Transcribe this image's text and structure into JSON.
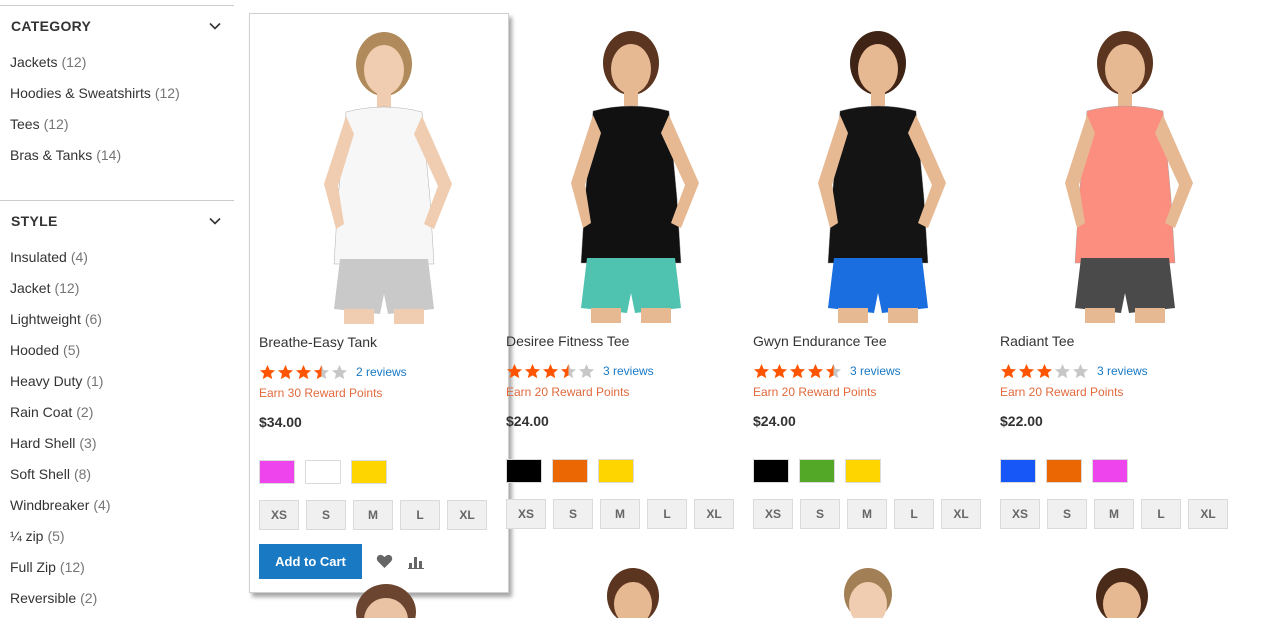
{
  "filters": {
    "category": {
      "title": "CATEGORY",
      "items": [
        {
          "label": "Jackets",
          "count": "(12)"
        },
        {
          "label": "Hoodies & Sweatshirts",
          "count": "(12)"
        },
        {
          "label": "Tees",
          "count": "(12)"
        },
        {
          "label": "Bras & Tanks",
          "count": "(14)"
        }
      ]
    },
    "style": {
      "title": "STYLE",
      "items": [
        {
          "label": "Insulated",
          "count": "(4)"
        },
        {
          "label": "Jacket",
          "count": "(12)"
        },
        {
          "label": "Lightweight",
          "count": "(6)"
        },
        {
          "label": "Hooded",
          "count": "(5)"
        },
        {
          "label": "Heavy Duty",
          "count": "(1)"
        },
        {
          "label": "Rain Coat",
          "count": "(2)"
        },
        {
          "label": "Hard Shell",
          "count": "(3)"
        },
        {
          "label": "Soft Shell",
          "count": "(8)"
        },
        {
          "label": "Windbreaker",
          "count": "(4)"
        },
        {
          "label": "¼ zip",
          "count": "(5)"
        },
        {
          "label": "Full Zip",
          "count": "(12)"
        },
        {
          "label": "Reversible",
          "count": "(2)"
        }
      ]
    }
  },
  "products": [
    {
      "name": "Breathe-Easy Tank",
      "rating": 3.5,
      "reviews": "2 reviews",
      "points": "Earn 30 Reward Points",
      "price": "$34.00",
      "swatches": [
        "#ee44ee",
        "#ffffff",
        "#ffd500"
      ],
      "top_color": "#f7f7f7",
      "bottom_color": "#c9c9c9",
      "hair_color": "#b08a5a"
    },
    {
      "name": "Desiree Fitness Tee",
      "rating": 3.5,
      "reviews": "3 reviews",
      "points": "Earn 20 Reward Points",
      "price": "$24.00",
      "swatches": [
        "#000000",
        "#eb6703",
        "#ffd500"
      ],
      "top_color": "#111111",
      "bottom_color": "#4fc2b0",
      "hair_color": "#5b3520"
    },
    {
      "name": "Gwyn Endurance Tee",
      "rating": 4.5,
      "reviews": "3 reviews",
      "points": "Earn 20 Reward Points",
      "price": "$24.00",
      "swatches": [
        "#000000",
        "#53a828",
        "#ffd500"
      ],
      "top_color": "#141414",
      "bottom_color": "#1a6ee0",
      "hair_color": "#3f2416"
    },
    {
      "name": "Radiant Tee",
      "rating": 3,
      "reviews": "3 reviews",
      "points": "Earn 20 Reward Points",
      "price": "$22.00",
      "swatches": [
        "#1857f7",
        "#eb6703",
        "#ee44ee"
      ],
      "top_color": "#fb8e7e",
      "bottom_color": "#4a4a4a",
      "hair_color": "#5b3520"
    }
  ],
  "sizes": [
    "XS",
    "S",
    "M",
    "L",
    "XL"
  ],
  "actions": {
    "add_to_cart": "Add to Cart",
    "wishlist_icon": "heart-icon",
    "compare_icon": "bar-chart-icon"
  },
  "colors": {
    "accent": "#1979c3",
    "star_filled": "#ff5501",
    "star_empty": "#c7c7c7",
    "reward_text": "#e06a3c"
  }
}
